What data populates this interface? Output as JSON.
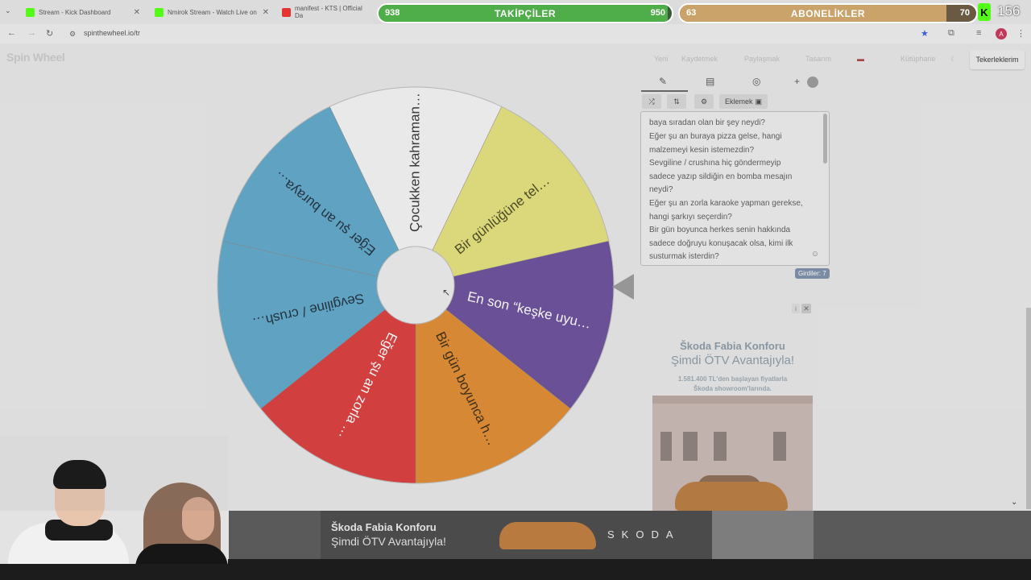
{
  "tabs": [
    {
      "title": "Stream - Kick Dashboard",
      "favicon_color": "#53fc18"
    },
    {
      "title": "Nmirok Stream - Watch Live on",
      "favicon_color": "#53fc18"
    },
    {
      "title": "manifest - KTS | Official Da",
      "favicon_color": "#e3342f"
    }
  ],
  "address": {
    "url": "spinthewheel.io/tr"
  },
  "site": {
    "logo": "Spin Wheel",
    "nav": [
      "Yeni",
      "Kaydetmek",
      "Paylaşmak",
      "Tasarım",
      "Kütüphane"
    ],
    "wheels_button": "Tekerleklerim"
  },
  "editor": {
    "add_button": "Eklemek",
    "entries_lines": [
      "baya sıradan olan bir şey neydi?",
      "Eğer şu an buraya pizza gelse, hangi",
      "malzemeyi kesin istemezdin?",
      "Sevgiline / crushına hiç göndermeyip",
      "sadece yazıp sildiğin en bomba mesajın",
      "neydi?",
      "Eğer şu an zorla karaoke yapman gerekse,",
      "hangi şarkıyı seçerdin?",
      "Bir gün boyunca herkes senin hakkında",
      "sadece doğruyu konuşacak olsa, kimi ilk",
      "susturmak isterdin?"
    ],
    "entries_count_label": "Girdiler: 7"
  },
  "wheel": {
    "segments": [
      {
        "label": "Çocukken kahraman…",
        "color": "#f4f4f4",
        "text_color": "#333333"
      },
      {
        "label": "Bir günlüğüne tel…",
        "color": "#e4e07c",
        "text_color": "#4a4a20"
      },
      {
        "label": "En son “keşke uyu…",
        "color": "#6a4e9a",
        "text_color": "#ffffff"
      },
      {
        "label": "Bir gün boyunca h…",
        "color": "#e08a30",
        "text_color": "#3a2a10"
      },
      {
        "label": "Eğer şu an zorla …",
        "color": "#d93b3b",
        "text_color": "#ffffff"
      },
      {
        "label": "Sevgiline / crush…",
        "color": "#5fa6c9",
        "text_color": "#1e2d3a"
      },
      {
        "label": "Eğer şu an buraya…",
        "color": "#5fa6c9",
        "text_color": "#1e2d3a"
      }
    ]
  },
  "ad_right": {
    "title": "Škoda Fabia Konforu",
    "subtitle": "Şimdi ÖTV Avantajıyla!",
    "text_1": "1.581.400 TL'den başlayan fiyatlarla",
    "text_2": "Škoda showroom'larında."
  },
  "ad_bottom": {
    "title": "Škoda Fabia Konforu",
    "subtitle": "Şimdi ÖTV Avantajıyla!",
    "brand": "SKODA"
  },
  "stream": {
    "followers": {
      "label": "TAKİPÇİLER",
      "current": "938",
      "goal": "950",
      "progress": 0.987,
      "color": "#4fae4a"
    },
    "subs": {
      "label": "ABONELİKLER",
      "current": "63",
      "goal": "70",
      "progress": 0.9,
      "color": "#c9a36a"
    },
    "viewers": "156",
    "kick_logo": "K"
  }
}
